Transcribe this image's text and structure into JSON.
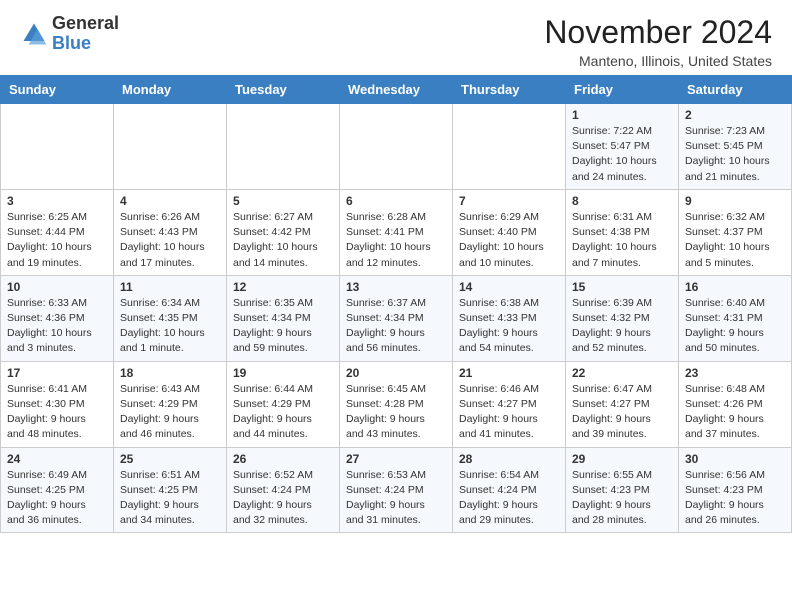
{
  "header": {
    "logo_general": "General",
    "logo_blue": "Blue",
    "month": "November 2024",
    "location": "Manteno, Illinois, United States"
  },
  "days_of_week": [
    "Sunday",
    "Monday",
    "Tuesday",
    "Wednesday",
    "Thursday",
    "Friday",
    "Saturday"
  ],
  "weeks": [
    [
      {
        "day": "",
        "info": ""
      },
      {
        "day": "",
        "info": ""
      },
      {
        "day": "",
        "info": ""
      },
      {
        "day": "",
        "info": ""
      },
      {
        "day": "",
        "info": ""
      },
      {
        "day": "1",
        "info": "Sunrise: 7:22 AM\nSunset: 5:47 PM\nDaylight: 10 hours\nand 24 minutes."
      },
      {
        "day": "2",
        "info": "Sunrise: 7:23 AM\nSunset: 5:45 PM\nDaylight: 10 hours\nand 21 minutes."
      }
    ],
    [
      {
        "day": "3",
        "info": "Sunrise: 6:25 AM\nSunset: 4:44 PM\nDaylight: 10 hours\nand 19 minutes."
      },
      {
        "day": "4",
        "info": "Sunrise: 6:26 AM\nSunset: 4:43 PM\nDaylight: 10 hours\nand 17 minutes."
      },
      {
        "day": "5",
        "info": "Sunrise: 6:27 AM\nSunset: 4:42 PM\nDaylight: 10 hours\nand 14 minutes."
      },
      {
        "day": "6",
        "info": "Sunrise: 6:28 AM\nSunset: 4:41 PM\nDaylight: 10 hours\nand 12 minutes."
      },
      {
        "day": "7",
        "info": "Sunrise: 6:29 AM\nSunset: 4:40 PM\nDaylight: 10 hours\nand 10 minutes."
      },
      {
        "day": "8",
        "info": "Sunrise: 6:31 AM\nSunset: 4:38 PM\nDaylight: 10 hours\nand 7 minutes."
      },
      {
        "day": "9",
        "info": "Sunrise: 6:32 AM\nSunset: 4:37 PM\nDaylight: 10 hours\nand 5 minutes."
      }
    ],
    [
      {
        "day": "10",
        "info": "Sunrise: 6:33 AM\nSunset: 4:36 PM\nDaylight: 10 hours\nand 3 minutes."
      },
      {
        "day": "11",
        "info": "Sunrise: 6:34 AM\nSunset: 4:35 PM\nDaylight: 10 hours\nand 1 minute."
      },
      {
        "day": "12",
        "info": "Sunrise: 6:35 AM\nSunset: 4:34 PM\nDaylight: 9 hours\nand 59 minutes."
      },
      {
        "day": "13",
        "info": "Sunrise: 6:37 AM\nSunset: 4:34 PM\nDaylight: 9 hours\nand 56 minutes."
      },
      {
        "day": "14",
        "info": "Sunrise: 6:38 AM\nSunset: 4:33 PM\nDaylight: 9 hours\nand 54 minutes."
      },
      {
        "day": "15",
        "info": "Sunrise: 6:39 AM\nSunset: 4:32 PM\nDaylight: 9 hours\nand 52 minutes."
      },
      {
        "day": "16",
        "info": "Sunrise: 6:40 AM\nSunset: 4:31 PM\nDaylight: 9 hours\nand 50 minutes."
      }
    ],
    [
      {
        "day": "17",
        "info": "Sunrise: 6:41 AM\nSunset: 4:30 PM\nDaylight: 9 hours\nand 48 minutes."
      },
      {
        "day": "18",
        "info": "Sunrise: 6:43 AM\nSunset: 4:29 PM\nDaylight: 9 hours\nand 46 minutes."
      },
      {
        "day": "19",
        "info": "Sunrise: 6:44 AM\nSunset: 4:29 PM\nDaylight: 9 hours\nand 44 minutes."
      },
      {
        "day": "20",
        "info": "Sunrise: 6:45 AM\nSunset: 4:28 PM\nDaylight: 9 hours\nand 43 minutes."
      },
      {
        "day": "21",
        "info": "Sunrise: 6:46 AM\nSunset: 4:27 PM\nDaylight: 9 hours\nand 41 minutes."
      },
      {
        "day": "22",
        "info": "Sunrise: 6:47 AM\nSunset: 4:27 PM\nDaylight: 9 hours\nand 39 minutes."
      },
      {
        "day": "23",
        "info": "Sunrise: 6:48 AM\nSunset: 4:26 PM\nDaylight: 9 hours\nand 37 minutes."
      }
    ],
    [
      {
        "day": "24",
        "info": "Sunrise: 6:49 AM\nSunset: 4:25 PM\nDaylight: 9 hours\nand 36 minutes."
      },
      {
        "day": "25",
        "info": "Sunrise: 6:51 AM\nSunset: 4:25 PM\nDaylight: 9 hours\nand 34 minutes."
      },
      {
        "day": "26",
        "info": "Sunrise: 6:52 AM\nSunset: 4:24 PM\nDaylight: 9 hours\nand 32 minutes."
      },
      {
        "day": "27",
        "info": "Sunrise: 6:53 AM\nSunset: 4:24 PM\nDaylight: 9 hours\nand 31 minutes."
      },
      {
        "day": "28",
        "info": "Sunrise: 6:54 AM\nSunset: 4:24 PM\nDaylight: 9 hours\nand 29 minutes."
      },
      {
        "day": "29",
        "info": "Sunrise: 6:55 AM\nSunset: 4:23 PM\nDaylight: 9 hours\nand 28 minutes."
      },
      {
        "day": "30",
        "info": "Sunrise: 6:56 AM\nSunset: 4:23 PM\nDaylight: 9 hours\nand 26 minutes."
      }
    ]
  ]
}
